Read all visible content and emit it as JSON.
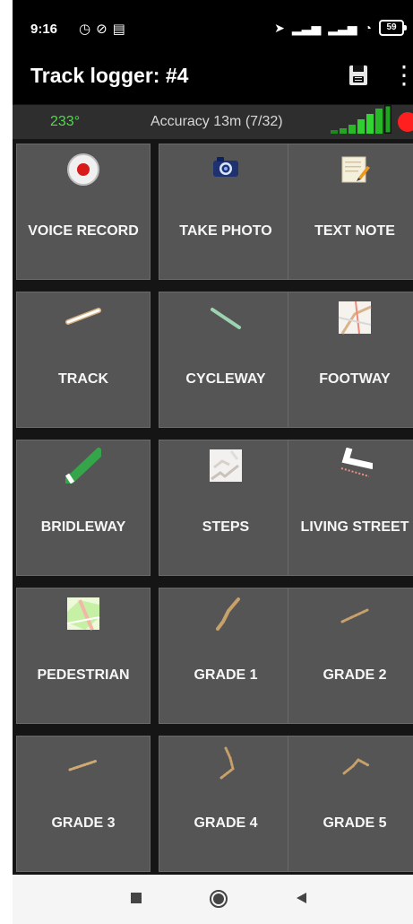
{
  "status": {
    "time": "9:16",
    "left_icons": [
      "alarm-icon",
      "do-not-disturb-icon",
      "notification-icon"
    ],
    "right_icons": [
      "location-arrow-icon",
      "signal-icon",
      "signal-icon",
      "wifi-icon"
    ],
    "battery": "59"
  },
  "toolbar": {
    "title": "Track logger: #4"
  },
  "info_bar": {
    "bearing": "233°",
    "accuracy": "Accuracy 13m (7/32)",
    "colors": {
      "bearing": "#52d94b",
      "rec": "#ff1f1f"
    }
  },
  "grid": {
    "tiles": [
      {
        "label": "VOICE RECORD",
        "icon": "voice-record-icon"
      },
      {
        "label": "TAKE PHOTO",
        "icon": "camera-icon"
      },
      {
        "label": "TEXT NOTE",
        "icon": "notepad-icon"
      },
      {
        "label": "TRACK",
        "icon": "track-icon"
      },
      {
        "label": "CYCLEWAY",
        "icon": "cycleway-icon"
      },
      {
        "label": "FOOTWAY",
        "icon": "footway-icon"
      },
      {
        "label": "BRIDLEWAY",
        "icon": "bridleway-icon"
      },
      {
        "label": "STEPS",
        "icon": "steps-icon"
      },
      {
        "label": "LIVING STREET",
        "icon": "living-street-icon"
      },
      {
        "label": "PEDESTRIAN",
        "icon": "pedestrian-icon"
      },
      {
        "label": "GRADE 1",
        "icon": "grade-1-icon"
      },
      {
        "label": "GRADE 2",
        "icon": "grade-2-icon"
      },
      {
        "label": "GRADE 3",
        "icon": "grade-3-icon"
      },
      {
        "label": "GRADE 4",
        "icon": "grade-4-icon"
      },
      {
        "label": "GRADE 5",
        "icon": "grade-5-icon"
      }
    ]
  },
  "nav": {
    "recent_icon": "square-icon",
    "home_icon": "circle-icon",
    "back_icon": "triangle-back-icon"
  }
}
